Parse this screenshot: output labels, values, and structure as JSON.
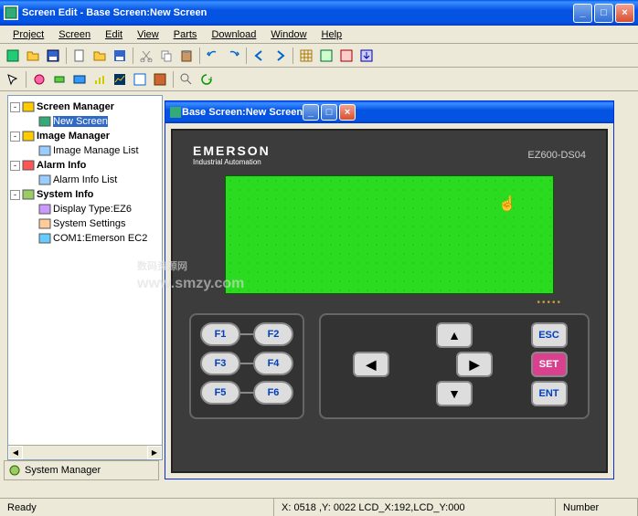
{
  "window": {
    "title": "Screen Edit - Base Screen:New Screen",
    "minimize": "_",
    "maximize": "□",
    "close": "×"
  },
  "menu": {
    "items": [
      "Project",
      "Screen",
      "Edit",
      "View",
      "Parts",
      "Download",
      "Window",
      "Help"
    ]
  },
  "child": {
    "title": "Base Screen:New Screen"
  },
  "tree": {
    "nodes": [
      {
        "toggle": "-",
        "bold": true,
        "label": "Screen Manager",
        "icon": "folder"
      },
      {
        "indent": 1,
        "label": "New Screen",
        "selected": true,
        "icon": "screen"
      },
      {
        "toggle": "-",
        "bold": true,
        "label": "Image Manager",
        "icon": "folder"
      },
      {
        "indent": 1,
        "label": "Image Manage List",
        "icon": "list"
      },
      {
        "toggle": "-",
        "bold": true,
        "label": "Alarm Info",
        "icon": "alarm"
      },
      {
        "indent": 1,
        "label": "Alarm Info List",
        "icon": "list"
      },
      {
        "toggle": "-",
        "bold": true,
        "label": "System Info",
        "icon": "gear"
      },
      {
        "indent": 1,
        "label": "Display Type:EZ6",
        "icon": "display"
      },
      {
        "indent": 1,
        "label": "System Settings",
        "icon": "settings"
      },
      {
        "indent": 1,
        "label": "COM1:Emerson EC2",
        "icon": "com"
      }
    ]
  },
  "sysmgr": {
    "label": "System Manager"
  },
  "hmi": {
    "brand": "EMERSON",
    "brand_sub": "Industrial Automation",
    "model": "EZ600-DS04",
    "fkeys": [
      "F1",
      "F2",
      "F3",
      "F4",
      "F5",
      "F6"
    ],
    "esc": "ESC",
    "set": "SET",
    "ent": "ENT",
    "dots": "•••••"
  },
  "status": {
    "ready": "Ready",
    "coords": "X: 0518 ,Y: 0022  LCD_X:192,LCD_Y:000",
    "number": "Number"
  },
  "watermark": {
    "main": "数码资源网",
    "sub": "www.smzy.com"
  }
}
